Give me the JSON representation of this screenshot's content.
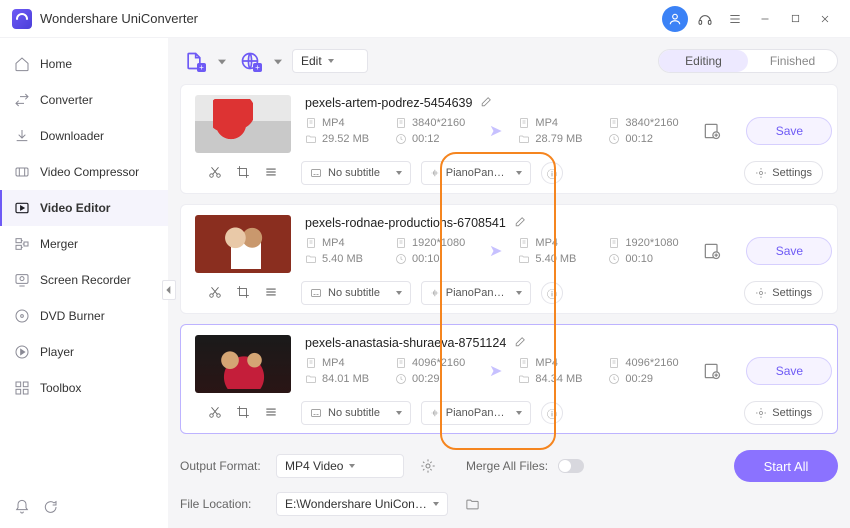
{
  "app_title": "Wondershare UniConverter",
  "sidebar": {
    "items": [
      {
        "label": "Home"
      },
      {
        "label": "Converter"
      },
      {
        "label": "Downloader"
      },
      {
        "label": "Video Compressor"
      },
      {
        "label": "Video Editor"
      },
      {
        "label": "Merger"
      },
      {
        "label": "Screen Recorder"
      },
      {
        "label": "DVD Burner"
      },
      {
        "label": "Player"
      },
      {
        "label": "Toolbox"
      }
    ],
    "active_index": 4
  },
  "toolbar": {
    "edit_dropdown": "Edit",
    "tabs": {
      "editing": "Editing",
      "finished": "Finished"
    }
  },
  "files": [
    {
      "name": "pexels-artem-podrez-5454639",
      "src": {
        "fmt": "MP4",
        "res": "3840*2160",
        "size": "29.52 MB",
        "dur": "00:12"
      },
      "out": {
        "fmt": "MP4",
        "res": "3840*2160",
        "size": "28.79 MB",
        "dur": "00:12"
      },
      "subtitle": "No subtitle",
      "audio": "PianoPanda - ...",
      "save": "Save",
      "settings": "Settings"
    },
    {
      "name": "pexels-rodnae-productions-6708541",
      "src": {
        "fmt": "MP4",
        "res": "1920*1080",
        "size": "5.40 MB",
        "dur": "00:10"
      },
      "out": {
        "fmt": "MP4",
        "res": "1920*1080",
        "size": "5.40 MB",
        "dur": "00:10"
      },
      "subtitle": "No subtitle",
      "audio": "PianoPanda - ...",
      "save": "Save",
      "settings": "Settings"
    },
    {
      "name": "pexels-anastasia-shuraeva-8751124",
      "src": {
        "fmt": "MP4",
        "res": "4096*2160",
        "size": "84.01 MB",
        "dur": "00:29"
      },
      "out": {
        "fmt": "MP4",
        "res": "4096*2160",
        "size": "84.34 MB",
        "dur": "00:29"
      },
      "subtitle": "No subtitle",
      "audio": "PianoPanda - ...",
      "save": "Save",
      "settings": "Settings"
    }
  ],
  "footer": {
    "output_format_label": "Output Format:",
    "output_format": "MP4 Video",
    "merge_label": "Merge All Files:",
    "file_location_label": "File Location:",
    "file_location": "E:\\Wondershare UniConverter",
    "start_all": "Start All"
  }
}
